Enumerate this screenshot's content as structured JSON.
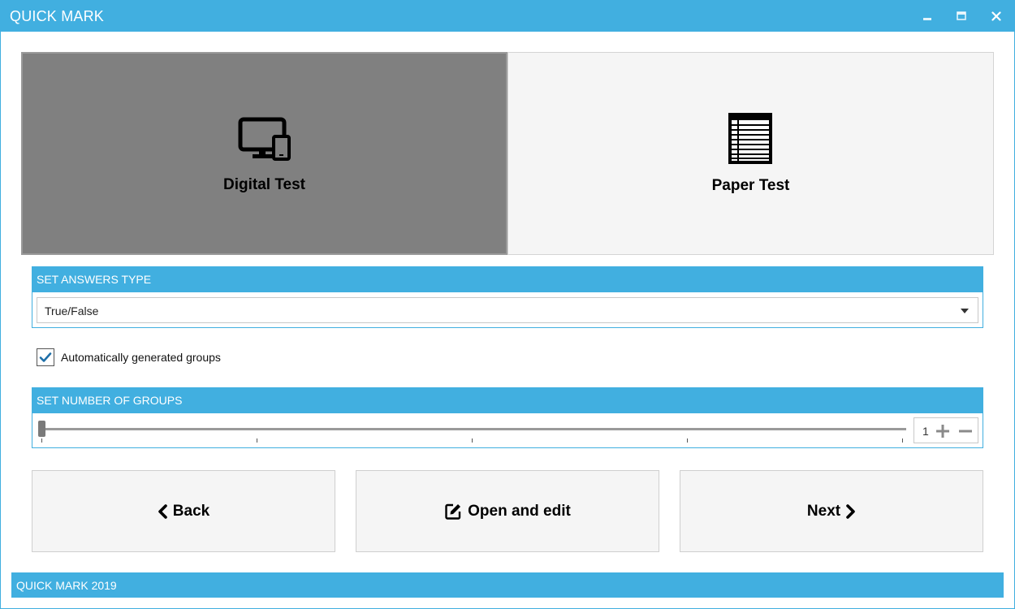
{
  "window": {
    "title": "QUICK MARK",
    "accent_color": "#41afe0",
    "controls": [
      "minimize-icon",
      "maximize-icon",
      "close-icon"
    ]
  },
  "modes": [
    {
      "label": "Digital Test",
      "icon": "devices-icon",
      "selected": true
    },
    {
      "label": "Paper Test",
      "icon": "paper-sheet-icon",
      "selected": false
    }
  ],
  "answers_type": {
    "header": "SET ANSWERS TYPE",
    "selected_value": "True/False"
  },
  "auto_groups": {
    "label": "Automatically generated groups",
    "checked": true
  },
  "groups": {
    "header": "SET NUMBER OF GROUPS",
    "value": "1"
  },
  "actions": {
    "back_label": "Back",
    "open_edit_label": "Open and edit",
    "next_label": "Next"
  },
  "footer": {
    "text": "QUICK MARK 2019"
  }
}
